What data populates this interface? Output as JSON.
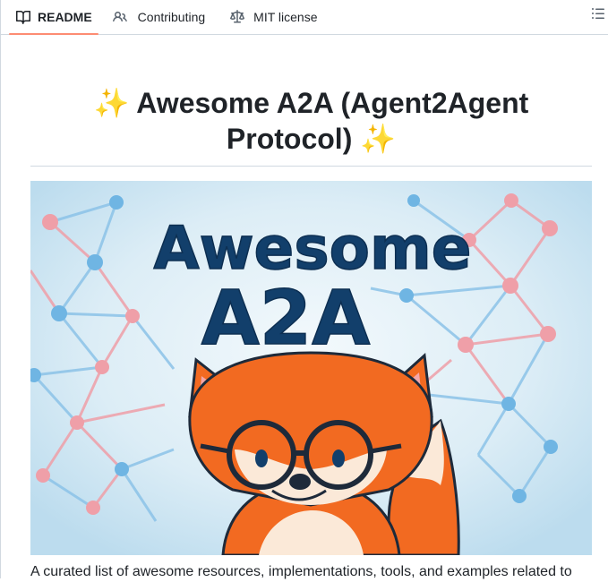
{
  "tabs": [
    {
      "label": "README",
      "icon": "book-icon",
      "active": true
    },
    {
      "label": "Contributing",
      "icon": "people-icon",
      "active": false
    },
    {
      "label": "MIT license",
      "icon": "law-icon",
      "active": false
    }
  ],
  "outline_button_icon": "list-unordered-icon",
  "readme": {
    "title_emoji": "✨",
    "title_line1": "Awesome A2A (Agent2Agent",
    "title_line2": "Protocol)",
    "banner": {
      "line1": "Awesome",
      "line2": "A2A",
      "description": "cartoon fox with glasses over network graph"
    },
    "intro": "A curated list of awesome resources, implementations, tools, and examples related to"
  },
  "colors": {
    "active_tab_underline": "#fd8c73",
    "border": "#d1d9e0",
    "banner_text": "#123f6b",
    "fox_orange": "#f26a21",
    "node_blue": "#6fb5e3",
    "node_pink": "#ef9fa8"
  }
}
